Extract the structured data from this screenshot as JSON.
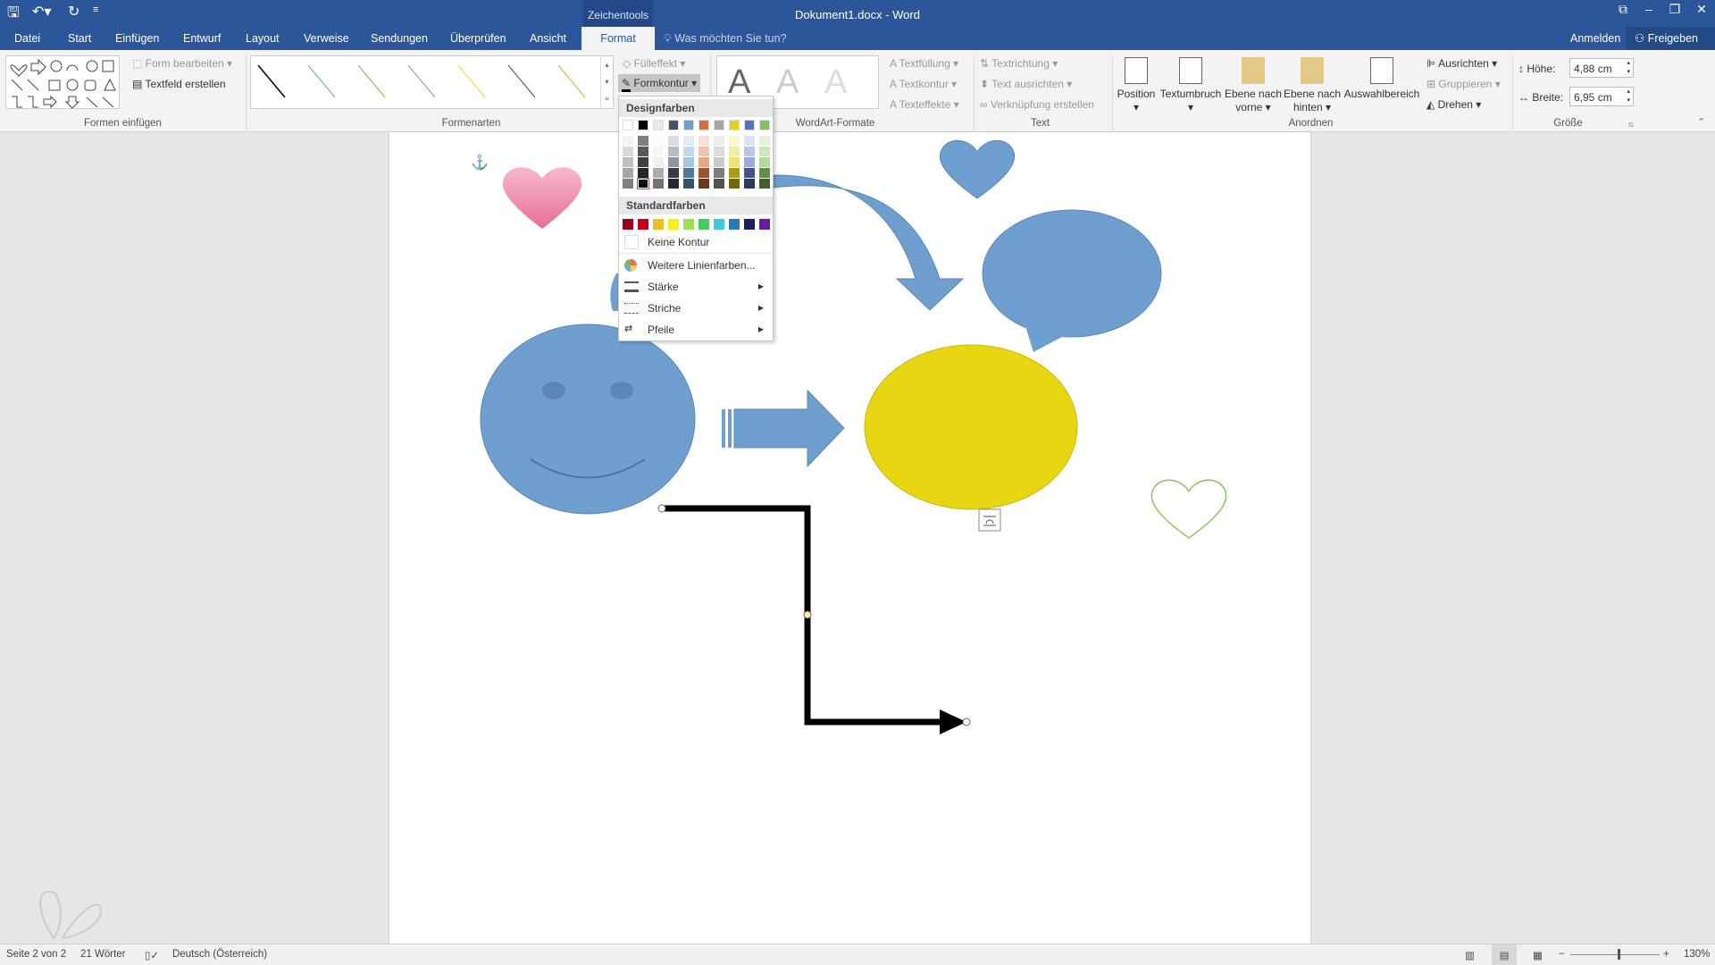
{
  "window": {
    "title": "Dokument1.docx - Word",
    "context_tab_group": "Zeichentools"
  },
  "tabs": [
    {
      "label": "Datei"
    },
    {
      "label": "Start"
    },
    {
      "label": "Einfügen"
    },
    {
      "label": "Entwurf"
    },
    {
      "label": "Layout"
    },
    {
      "label": "Verweise"
    },
    {
      "label": "Sendungen"
    },
    {
      "label": "Überprüfen"
    },
    {
      "label": "Ansicht"
    },
    {
      "label": "Format",
      "active": true
    }
  ],
  "tell_me": "Was möchten Sie tun?",
  "account": {
    "signin": "Anmelden",
    "share": "Freigeben"
  },
  "ribbon": {
    "insert_shapes": {
      "label": "Formen einfügen",
      "edit_shape": "Form bearbeiten",
      "text_box": "Textfeld erstellen"
    },
    "shape_styles": {
      "label": "Formenarten",
      "fill": "Fülleffekt",
      "outline": "Formkontur",
      "line_colors": [
        "#000000",
        "#6f9fcf",
        "#b5a040",
        "#9a9a9a",
        "#e8e020",
        "#44506a",
        "#a8c040"
      ]
    },
    "wordart": {
      "label": "WordArt-Formate",
      "text_fill": "Textfüllung",
      "text_outline": "Textkontur",
      "text_effects": "Texteffekte"
    },
    "text": {
      "label": "Text",
      "direction": "Textrichtung",
      "align": "Text ausrichten",
      "link": "Verknüpfung erstellen"
    },
    "arrange": {
      "label": "Anordnen",
      "position": "Position",
      "wrap": "Textumbruch",
      "forward_1": "Ebene nach",
      "forward_2": "vorne",
      "backward_1": "Ebene nach",
      "backward_2": "hinten",
      "selection_pane": "Auswahlbereich",
      "align": "Ausrichten",
      "group": "Gruppieren",
      "rotate": "Drehen"
    },
    "size": {
      "label": "Größe",
      "height_label": "Höhe:",
      "height_value": "4,88 cm",
      "width_label": "Breite:",
      "width_value": "6,95 cm"
    }
  },
  "outline_menu": {
    "theme_colors_title": "Designfarben",
    "theme_colors": [
      "#ffffff",
      "#000000",
      "#e7e6e6",
      "#44546a",
      "#5b9bd5",
      "#ed7d31",
      "#a5a5a5",
      "#ffc000",
      "#4472c4",
      "#70ad47"
    ],
    "theme_display": [
      "#ffffff",
      "#000000",
      "#e8e8e8",
      "#4a4f68",
      "#6f9fcf",
      "#d0703e",
      "#a6a6a6",
      "#e0d020",
      "#5a6fbf",
      "#80c060"
    ],
    "standard_colors_title": "Standardfarben",
    "standard_colors": [
      "#a00018",
      "#c8001e",
      "#e8c020",
      "#f4f020",
      "#a0e050",
      "#40d060",
      "#40c8e0",
      "#2f78b8",
      "#1a2060",
      "#6a1aa0"
    ],
    "selected_color": "#000000",
    "no_outline": "Keine Kontur",
    "more_colors": "Weitere Linienfarben...",
    "weight": "Stärke",
    "dashes": "Striche",
    "arrows": "Pfeile"
  },
  "status": {
    "page": "Seite 2 von 2",
    "words": "21 Wörter",
    "language": "Deutsch (Österreich)",
    "zoom": "130%",
    "zoom_percent": 130
  }
}
